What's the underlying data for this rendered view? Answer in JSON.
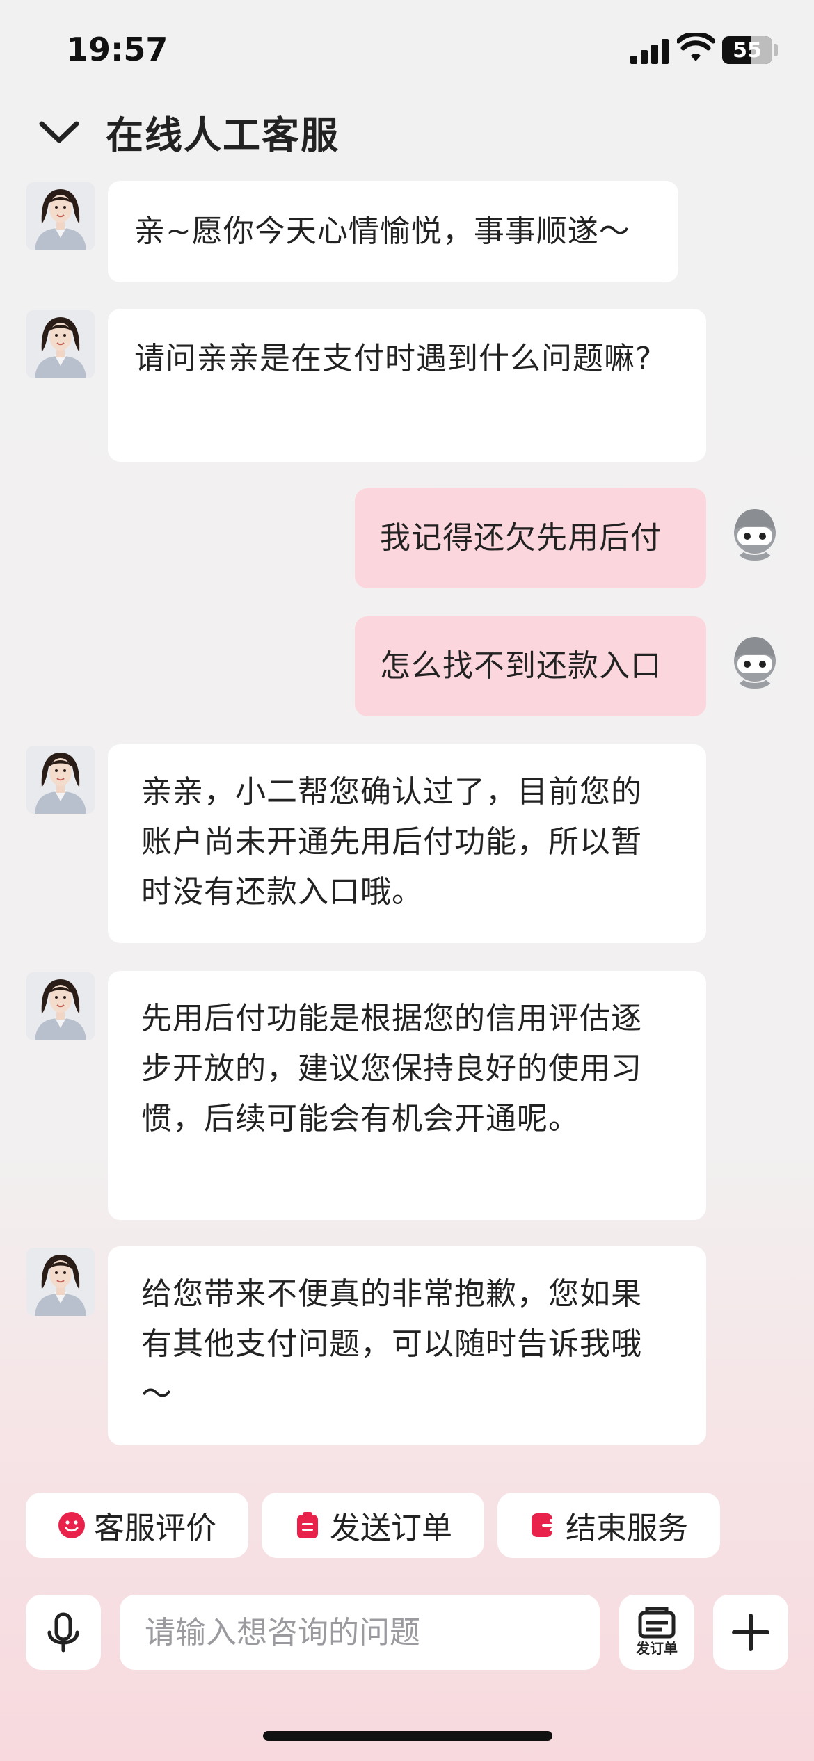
{
  "status_bar": {
    "time": "19:57",
    "battery_level": "55"
  },
  "header": {
    "title": "在线人工客服"
  },
  "messages": [
    {
      "side": "left",
      "text": "亲~愿你今天心情愉悦，事事顺遂～"
    },
    {
      "side": "left",
      "text": "请问亲亲是在支付时遇到什么问题嘛?"
    },
    {
      "side": "right",
      "text": "我记得还欠先用后付"
    },
    {
      "side": "right",
      "text": "怎么找不到还款入口"
    },
    {
      "side": "left",
      "text": "亲亲，小二帮您确认过了，目前您的账户尚未开通先用后付功能，所以暂时没有还款入口哦。"
    },
    {
      "side": "left",
      "text": "先用后付功能是根据您的信用评估逐步开放的，建议您保持良好的使用习惯，后续可能会有机会开通呢。"
    },
    {
      "side": "left",
      "text": "给您带来不便真的非常抱歉，您如果有其他支付问题，可以随时告诉我哦～"
    }
  ],
  "quick_actions": [
    {
      "label": "客服评价",
      "icon": "smile-face-icon"
    },
    {
      "label": "发送订单",
      "icon": "clipboard-icon"
    },
    {
      "label": "结束服务",
      "icon": "exit-icon"
    }
  ],
  "input_bar": {
    "placeholder": "请输入想咨询的问题",
    "order_button_label": "发订单"
  },
  "colors": {
    "accent": "#e8224a",
    "user_bubble": "#fbd7dd",
    "agent_bubble": "#ffffff"
  },
  "icons": {
    "back": "chevron-down-icon",
    "voice": "microphone-icon",
    "order": "order-icon",
    "plus": "plus-icon"
  }
}
